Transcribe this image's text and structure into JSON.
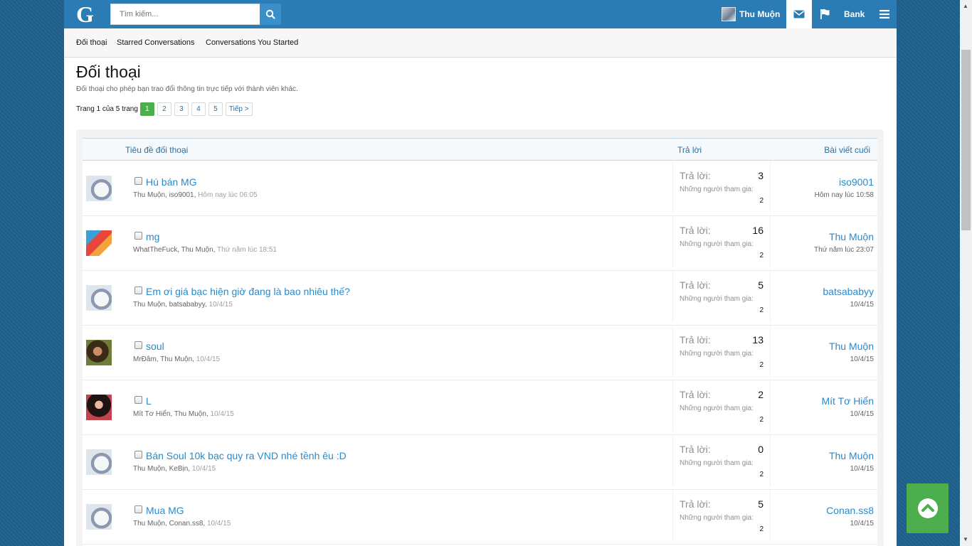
{
  "header": {
    "logo": "G",
    "search_placeholder": "Tìm kiếm...",
    "user_name": "Thu Muộn",
    "bank_label": "Bank"
  },
  "subnav": {
    "items": [
      "Đối thoại",
      "Starred Conversations",
      "Conversations You Started"
    ]
  },
  "page": {
    "title": "Đối thoại",
    "description": "Đối thoại cho phép bạn trao đổi thông tin trực tiếp với thành viên khác.",
    "page_info": "Trang 1 của 5 trang",
    "pages": [
      "1",
      "2",
      "3",
      "4",
      "5"
    ],
    "next_label": "Tiếp >"
  },
  "list_header": {
    "title_col": "Tiêu đề đối thoại",
    "replies_col": "Trả lời",
    "last_post_col": "Bài viết cuối"
  },
  "labels": {
    "replies": "Trả lời:",
    "participants": "Những người tham gia:"
  },
  "conversations": [
    {
      "title": "Hú bán MG",
      "participants": "Thu Muộn, iso9001,",
      "date": "Hôm nay lúc 06:05",
      "replies": "3",
      "participant_count": "2",
      "last_user": "iso9001",
      "last_date": "Hôm nay lúc 10:58"
    },
    {
      "title": "mg",
      "participants": "WhatTheFuck, Thu Muộn,",
      "date": "Thứ năm lúc 18:51",
      "replies": "16",
      "participant_count": "2",
      "last_user": "Thu Muộn",
      "last_date": "Thứ năm lúc 23:07"
    },
    {
      "title": "Em ơi giá bạc hiện giờ đang là bao nhiêu thế?",
      "participants": "Thu Muộn, batsababyy,",
      "date": "10/4/15",
      "replies": "5",
      "participant_count": "2",
      "last_user": "batsababyy",
      "last_date": "10/4/15"
    },
    {
      "title": "soul",
      "participants": "MrĐâm, Thu Muộn,",
      "date": "10/4/15",
      "replies": "13",
      "participant_count": "2",
      "last_user": "Thu Muộn",
      "last_date": "10/4/15"
    },
    {
      "title": "L",
      "participants": "Mít Tơ Hiển, Thu Muộn,",
      "date": "10/4/15",
      "replies": "2",
      "participant_count": "2",
      "last_user": "Mít Tơ Hiển",
      "last_date": "10/4/15"
    },
    {
      "title": "Bán Soul 10k bạc quy ra VND nhé tềnh êu :D",
      "participants": "Thu Muộn, KeBịn,",
      "date": "10/4/15",
      "replies": "0",
      "participant_count": "2",
      "last_user": "Thu Muộn",
      "last_date": "10/4/15"
    },
    {
      "title": "Mua MG",
      "participants": "Thu Muộn, Conan.ss8,",
      "date": "10/4/15",
      "replies": "5",
      "participant_count": "2",
      "last_user": "Conan.ss8",
      "last_date": "10/4/15"
    }
  ],
  "colors": {
    "accent": "#2b7bb4",
    "link": "#2b8ac9",
    "current_page": "#4cae4c"
  }
}
